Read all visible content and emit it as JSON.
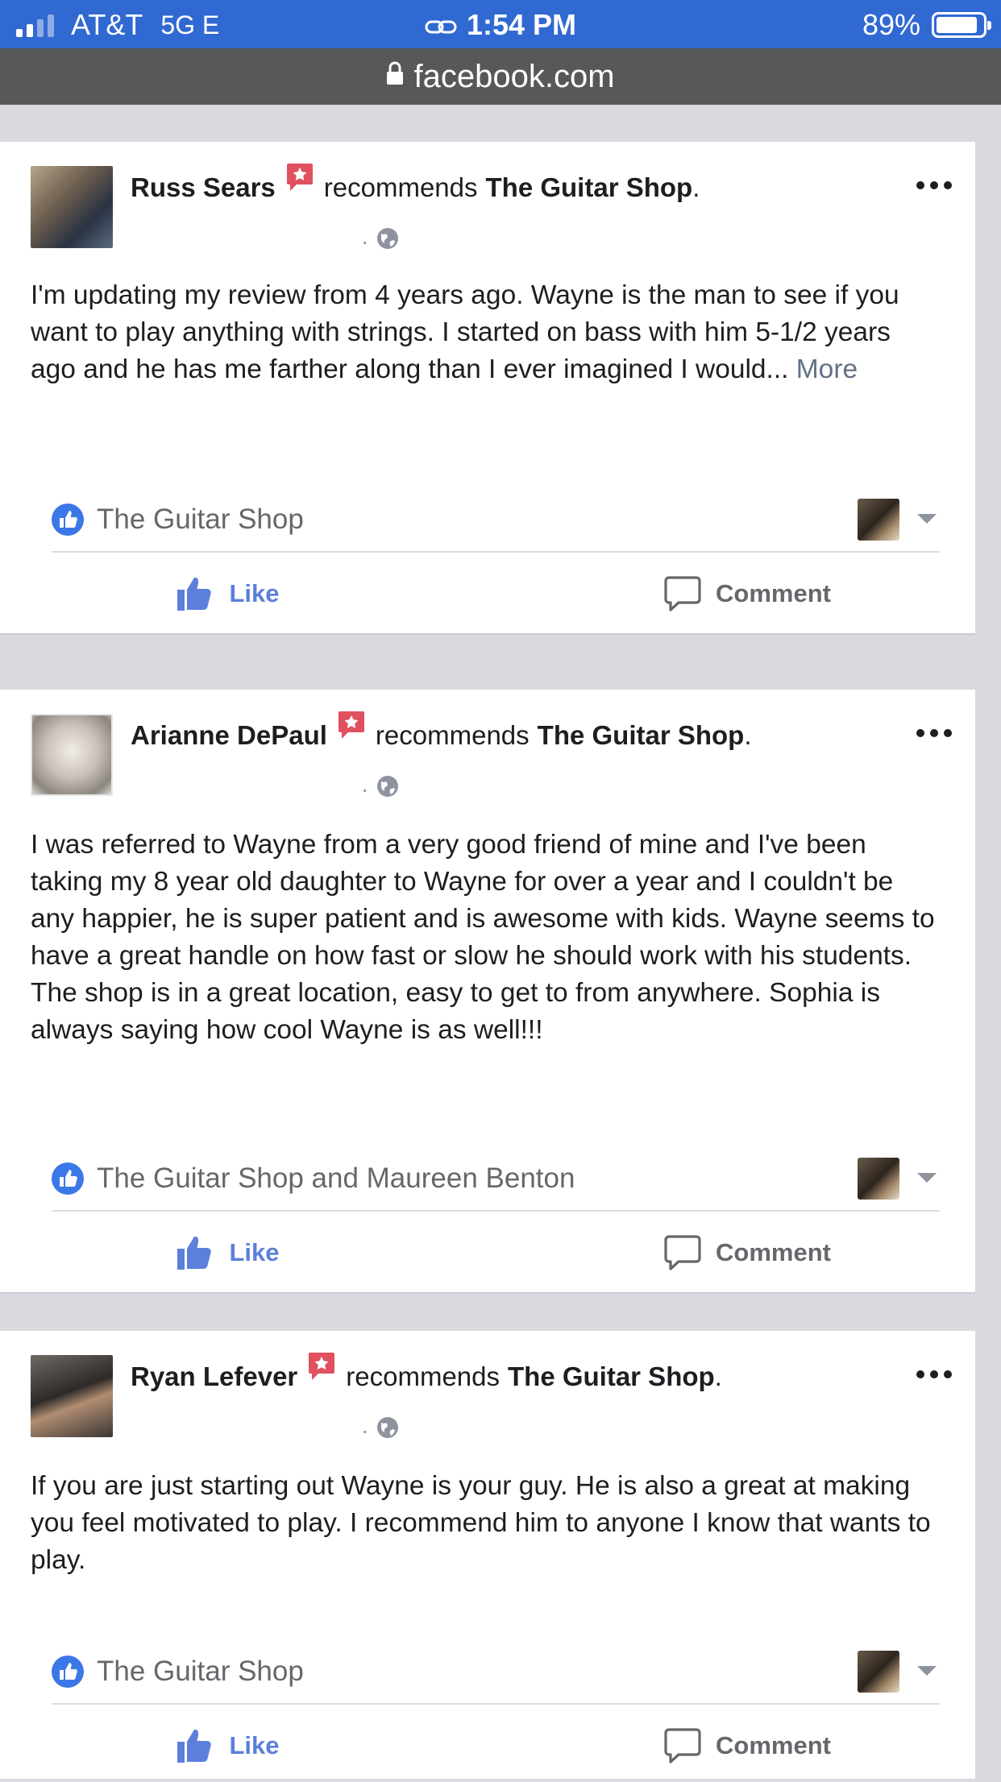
{
  "status_bar": {
    "carrier": "AT&T",
    "network": "5G E",
    "time": "1:54 PM",
    "battery_percent": "89%",
    "battery_level": 0.89,
    "signal_bars_on": 2,
    "signal_bars_total": 4
  },
  "url_bar": {
    "domain": "facebook.com"
  },
  "colors": {
    "status_bar_bg": "#3169d2",
    "url_bar_bg": "#57585a",
    "like_blue": "#5b7fdb",
    "badge_red": "#e0505e",
    "feed_gap": "#d8dadf"
  },
  "posts": [
    {
      "author": "Russ Sears",
      "verb": "recommends",
      "page": "The Guitar Shop",
      "period": ".",
      "body": "I'm updating my review from 4 years ago. Wayne is the man to see if you want to play anything with strings. I started on bass with him 5-1/2 years ago and he has me farther along than I ever imagined I would...",
      "more": "More",
      "reactions_text": "The Guitar Shop",
      "like_label": "Like",
      "comment_label": "Comment"
    },
    {
      "author": "Arianne DePaul",
      "verb": "recommends",
      "page": "The Guitar Shop",
      "period": ".",
      "body": "I was referred to Wayne from a very good friend of mine and I've been taking my 8 year old daughter to Wayne for over a year and I couldn't be any happier, he is super patient and is awesome with kids. Wayne seems to have a great handle on how fast or slow he should work with his students. The shop is in a great location, easy to get to from anywhere. Sophia is always saying how cool Wayne is as well!!!",
      "reactions_text": "The Guitar Shop and Maureen Benton",
      "like_label": "Like",
      "comment_label": "Comment"
    },
    {
      "author": "Ryan Lefever",
      "verb": "recommends",
      "page": "The Guitar Shop",
      "period": ".",
      "body": "If you are just starting out Wayne is your guy. He is also a great at making you feel motivated to play. I recommend him to anyone I know that wants to play.",
      "reactions_text": "The Guitar Shop",
      "like_label": "Like",
      "comment_label": "Comment"
    }
  ],
  "icons": {
    "recommend_badge": "recommendation-badge-icon",
    "audience": "globe-icon",
    "more": "more-options-icon",
    "like_reaction": "like-reaction-icon",
    "like": "thumbs-up-icon",
    "comment": "comment-bubble-icon",
    "dropdown": "chevron-down-icon",
    "lock": "lock-icon",
    "link": "link-icon"
  }
}
